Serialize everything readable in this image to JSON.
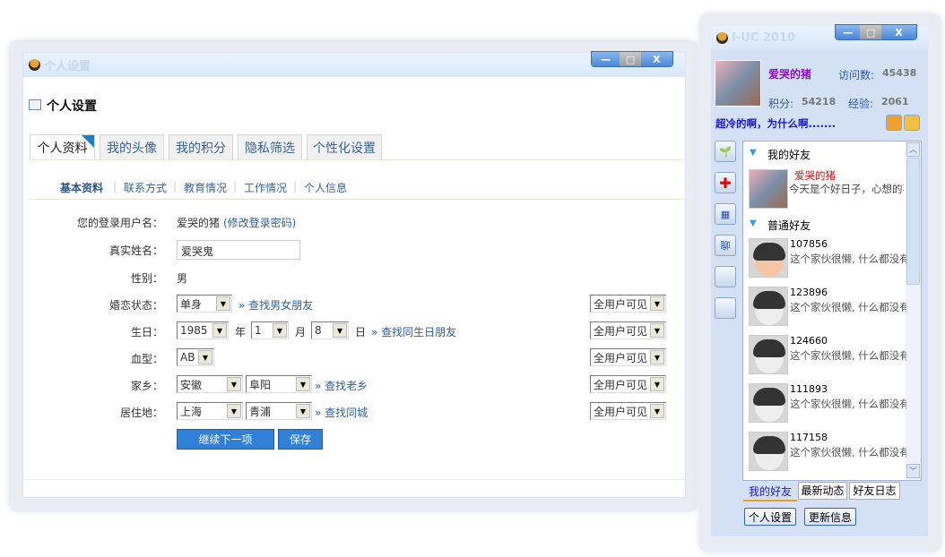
{
  "main_window": {
    "title": "个人设置",
    "controls": {
      "minimize": "—",
      "maximize": "□",
      "close": "X"
    },
    "heading": "个人设置",
    "tabs": [
      {
        "label": "个人资料",
        "active": true
      },
      {
        "label": "我的头像"
      },
      {
        "label": "我的积分"
      },
      {
        "label": "隐私筛选"
      },
      {
        "label": "个性化设置"
      }
    ],
    "subnav": [
      {
        "label": "基本资料",
        "active": true
      },
      {
        "label": "联系方式"
      },
      {
        "label": "教育情况"
      },
      {
        "label": "工作情况"
      },
      {
        "label": "个人信息"
      }
    ],
    "form": {
      "username_label": "您的登录用户名：",
      "username": "爱哭的猪",
      "change_password": "(修改登录密码)",
      "realname_label": "真实姓名：",
      "realname": "爱哭鬼",
      "gender_label": "性别：",
      "gender": "男",
      "marital_label": "婚恋状态：",
      "marital": "单身",
      "marital_link": "» 查找男女朋友",
      "birthday_label": "生日：",
      "year": "1985",
      "year_unit": "年",
      "month": "1",
      "month_unit": "月",
      "day": "8",
      "day_unit": "日",
      "birthday_link": "» 查找同生日朋友",
      "blood_label": "血型：",
      "blood": "AB",
      "hometown_label": "家乡：",
      "hometown_province": "安徽",
      "hometown_city": "阜阳",
      "hometown_link": "» 查找老乡",
      "residence_label": "居住地：",
      "residence_province": "上海",
      "residence_city": "青浦",
      "residence_link": "» 查找同城",
      "visibility": [
        "全用户可见",
        "全用户可见",
        "全用户可见",
        "全用户可见",
        "全用户可见"
      ],
      "next_button": "继续下一项",
      "save_button": "保存"
    }
  },
  "side_window": {
    "title": "I-UC 2010",
    "controls": {
      "minimize": "—",
      "maximize": "□",
      "close": "X"
    },
    "nickname": "爱哭的猪",
    "visits_label": "访问数:",
    "visits": "45438",
    "points_label": "积分:",
    "points": "54218",
    "exp_label": "经验:",
    "exp": "2061",
    "status": "超冷的啊，为什么啊.......",
    "chat_label": "聊",
    "groups": [
      {
        "name": "我的好友"
      },
      {
        "name": "普通好友"
      }
    ],
    "me": {
      "name": "爱哭的猪",
      "msg": "今天是个好日子，心想的事儿都能成"
    },
    "friends": [
      {
        "id": "107856",
        "msg": "这个家伙很懒, 什么都没有留下"
      },
      {
        "id": "123896",
        "msg": "这个家伙很懒, 什么都没有留下"
      },
      {
        "id": "124660",
        "msg": "这个家伙很懒, 什么都没有留下"
      },
      {
        "id": "111893",
        "msg": "这个家伙很懒, 什么都没有留下"
      },
      {
        "id": "117158",
        "msg": "这个家伙很懒, 什么都没有留下"
      }
    ],
    "bottom_tabs": [
      "我的好友",
      "最新动态",
      "好友日志"
    ],
    "settings_button": "个人设置",
    "update_button": "更新信息"
  }
}
